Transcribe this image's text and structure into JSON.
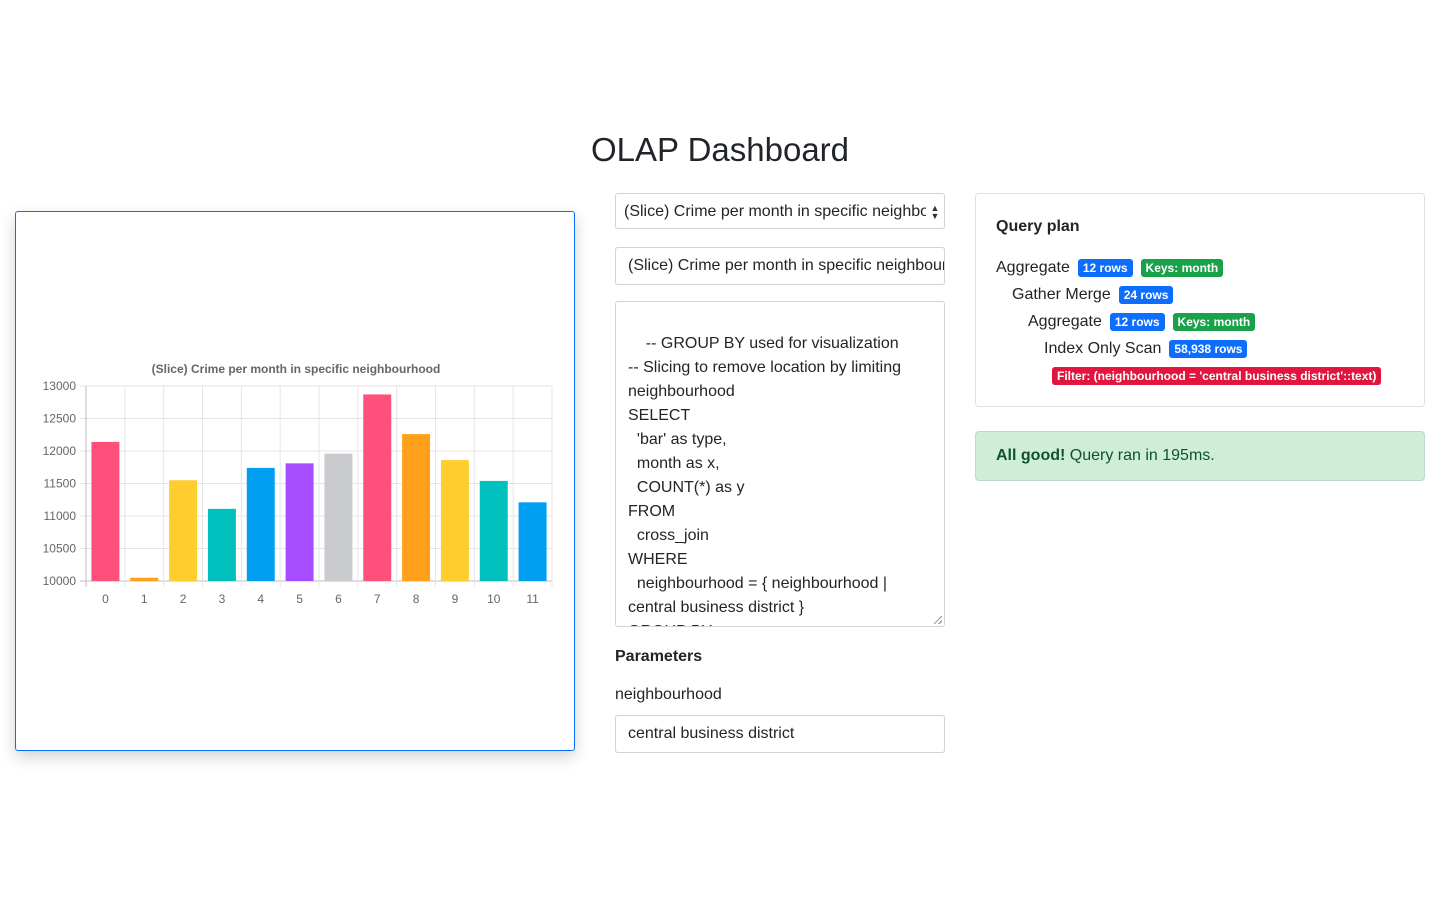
{
  "page": {
    "title": "OLAP Dashboard"
  },
  "form": {
    "query_select_value": "(Slice) Crime per month in specific neighbourhood",
    "query_name_value": "(Slice) Crime per month in specific neighbourhood",
    "sql_text": "-- GROUP BY used for visualization\n-- Slicing to remove location by limiting neighbourhood\nSELECT\n  'bar' as type,\n  month as x,\n  COUNT(*) as y\nFROM\n  cross_join\nWHERE\n  neighbourhood = { neighbourhood | central business district }\nGROUP BY\n  month",
    "parameters_heading": "Parameters",
    "param_label": "neighbourhood",
    "param_value": "central business district"
  },
  "plan": {
    "title": "Query plan",
    "nodes": [
      {
        "node": "Aggregate",
        "rows": "12 rows",
        "keys": "Keys: month"
      },
      {
        "node": "Gather Merge",
        "rows": "24 rows"
      },
      {
        "node": "Aggregate",
        "rows": "12 rows",
        "keys": "Keys: month"
      },
      {
        "node": "Index Only Scan",
        "rows": "58,938 rows",
        "filter": "Filter: (neighbourhood = 'central business district'::text)"
      }
    ]
  },
  "alert": {
    "strong": "All good!",
    "message": " Query ran in 195ms."
  },
  "colors": {
    "accent": "#0d6efd",
    "badge_blue": "#0d6efd",
    "badge_green": "#1aa24a",
    "badge_red": "#e0163e",
    "alert_bg": "#cfeed9"
  },
  "chart_data": {
    "type": "bar",
    "title": "(Slice) Crime per month in specific neighbourhood",
    "categories": [
      "0",
      "1",
      "2",
      "3",
      "4",
      "5",
      "6",
      "7",
      "8",
      "9",
      "10",
      "11"
    ],
    "values": [
      12140,
      10050,
      11550,
      11110,
      11740,
      11810,
      11960,
      12870,
      12260,
      11860,
      11540,
      11210
    ],
    "colors": [
      "#ff4f7b",
      "#ff9f1a",
      "#ffcd2e",
      "#00c1bd",
      "#009ff2",
      "#a64dff",
      "#c9cbcf",
      "#ff4f7b",
      "#ff9f1a",
      "#ffcd2e",
      "#00c1bd",
      "#009ff2"
    ],
    "yticks": [
      10000,
      10500,
      11000,
      11500,
      12000,
      12500,
      13000
    ],
    "ylim": [
      10000,
      13000
    ],
    "grid": true,
    "legend": "none",
    "xlabel": "",
    "ylabel": ""
  }
}
